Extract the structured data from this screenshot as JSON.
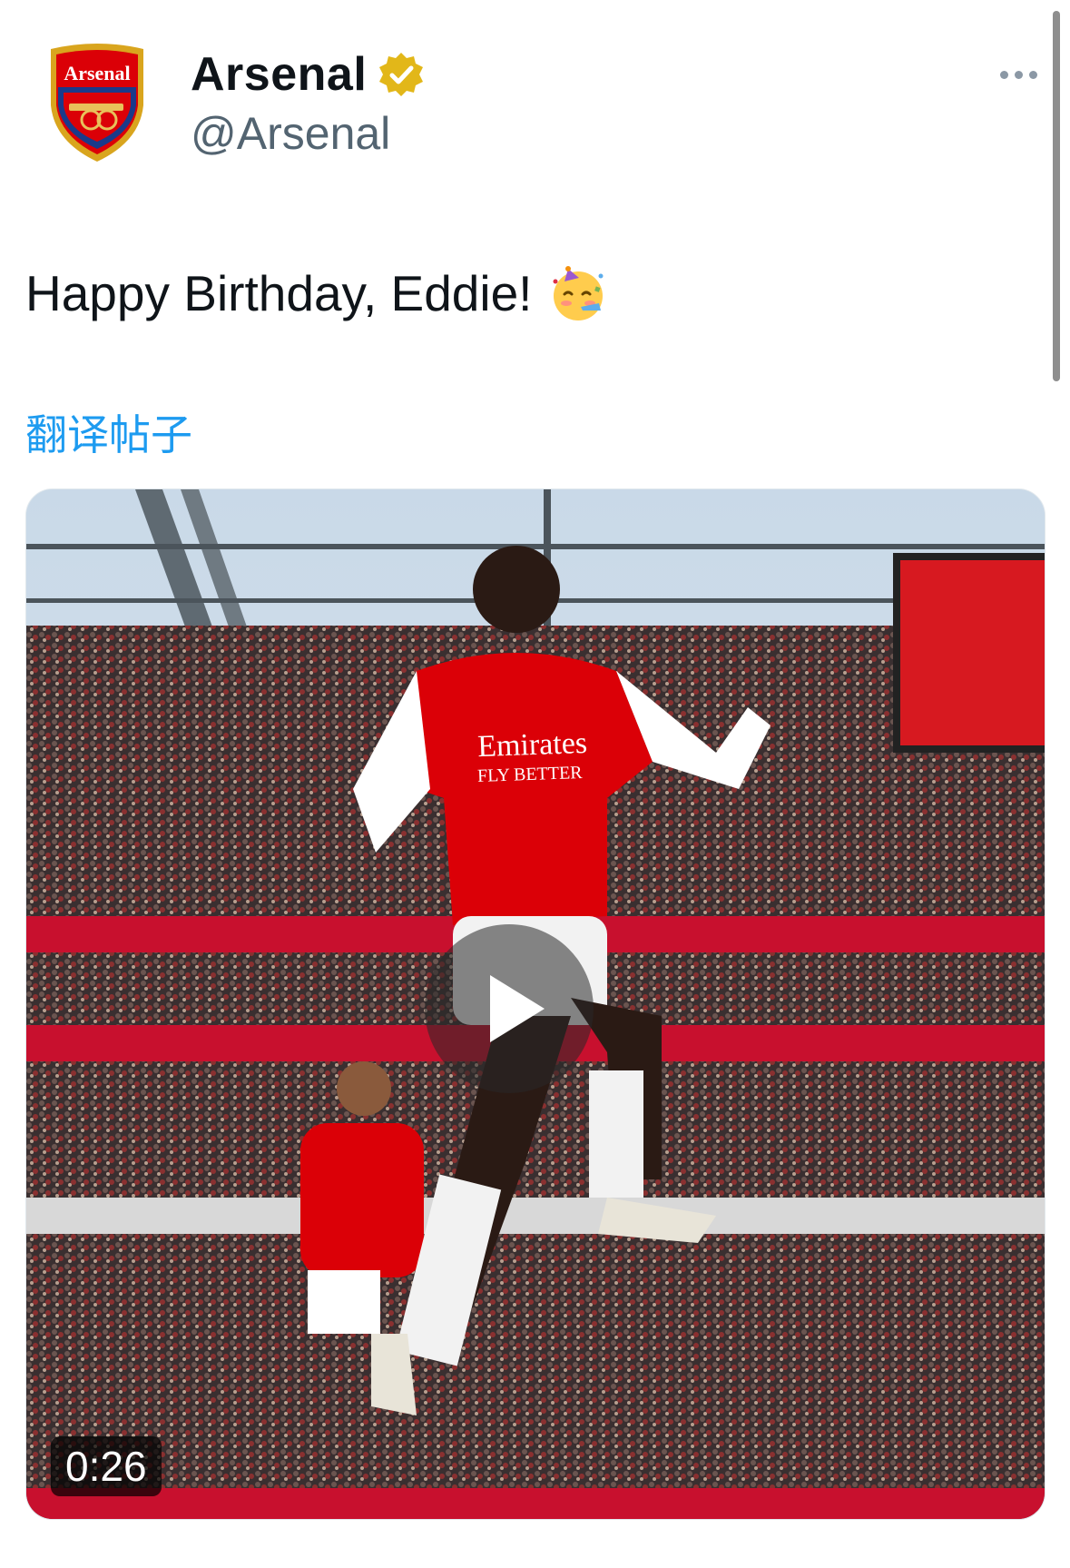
{
  "tweet": {
    "author": {
      "display_name": "Arsenal",
      "handle": "@Arsenal",
      "crest_text": "Arsenal",
      "verified_icon": "verified-badge-icon"
    },
    "text": "Happy Birthday, Eddie!",
    "emoji": "partying-face",
    "translate_label": "翻译帖子",
    "media": {
      "type": "video",
      "duration": "0:26",
      "play_icon": "play-icon",
      "jersey_text_line1": "Emirates",
      "jersey_text_line2": "FLY BETTER"
    }
  },
  "colors": {
    "brand_blue": "#1d9bf0",
    "arsenal_red": "#db0007",
    "verified_gold": "#e2b719"
  }
}
